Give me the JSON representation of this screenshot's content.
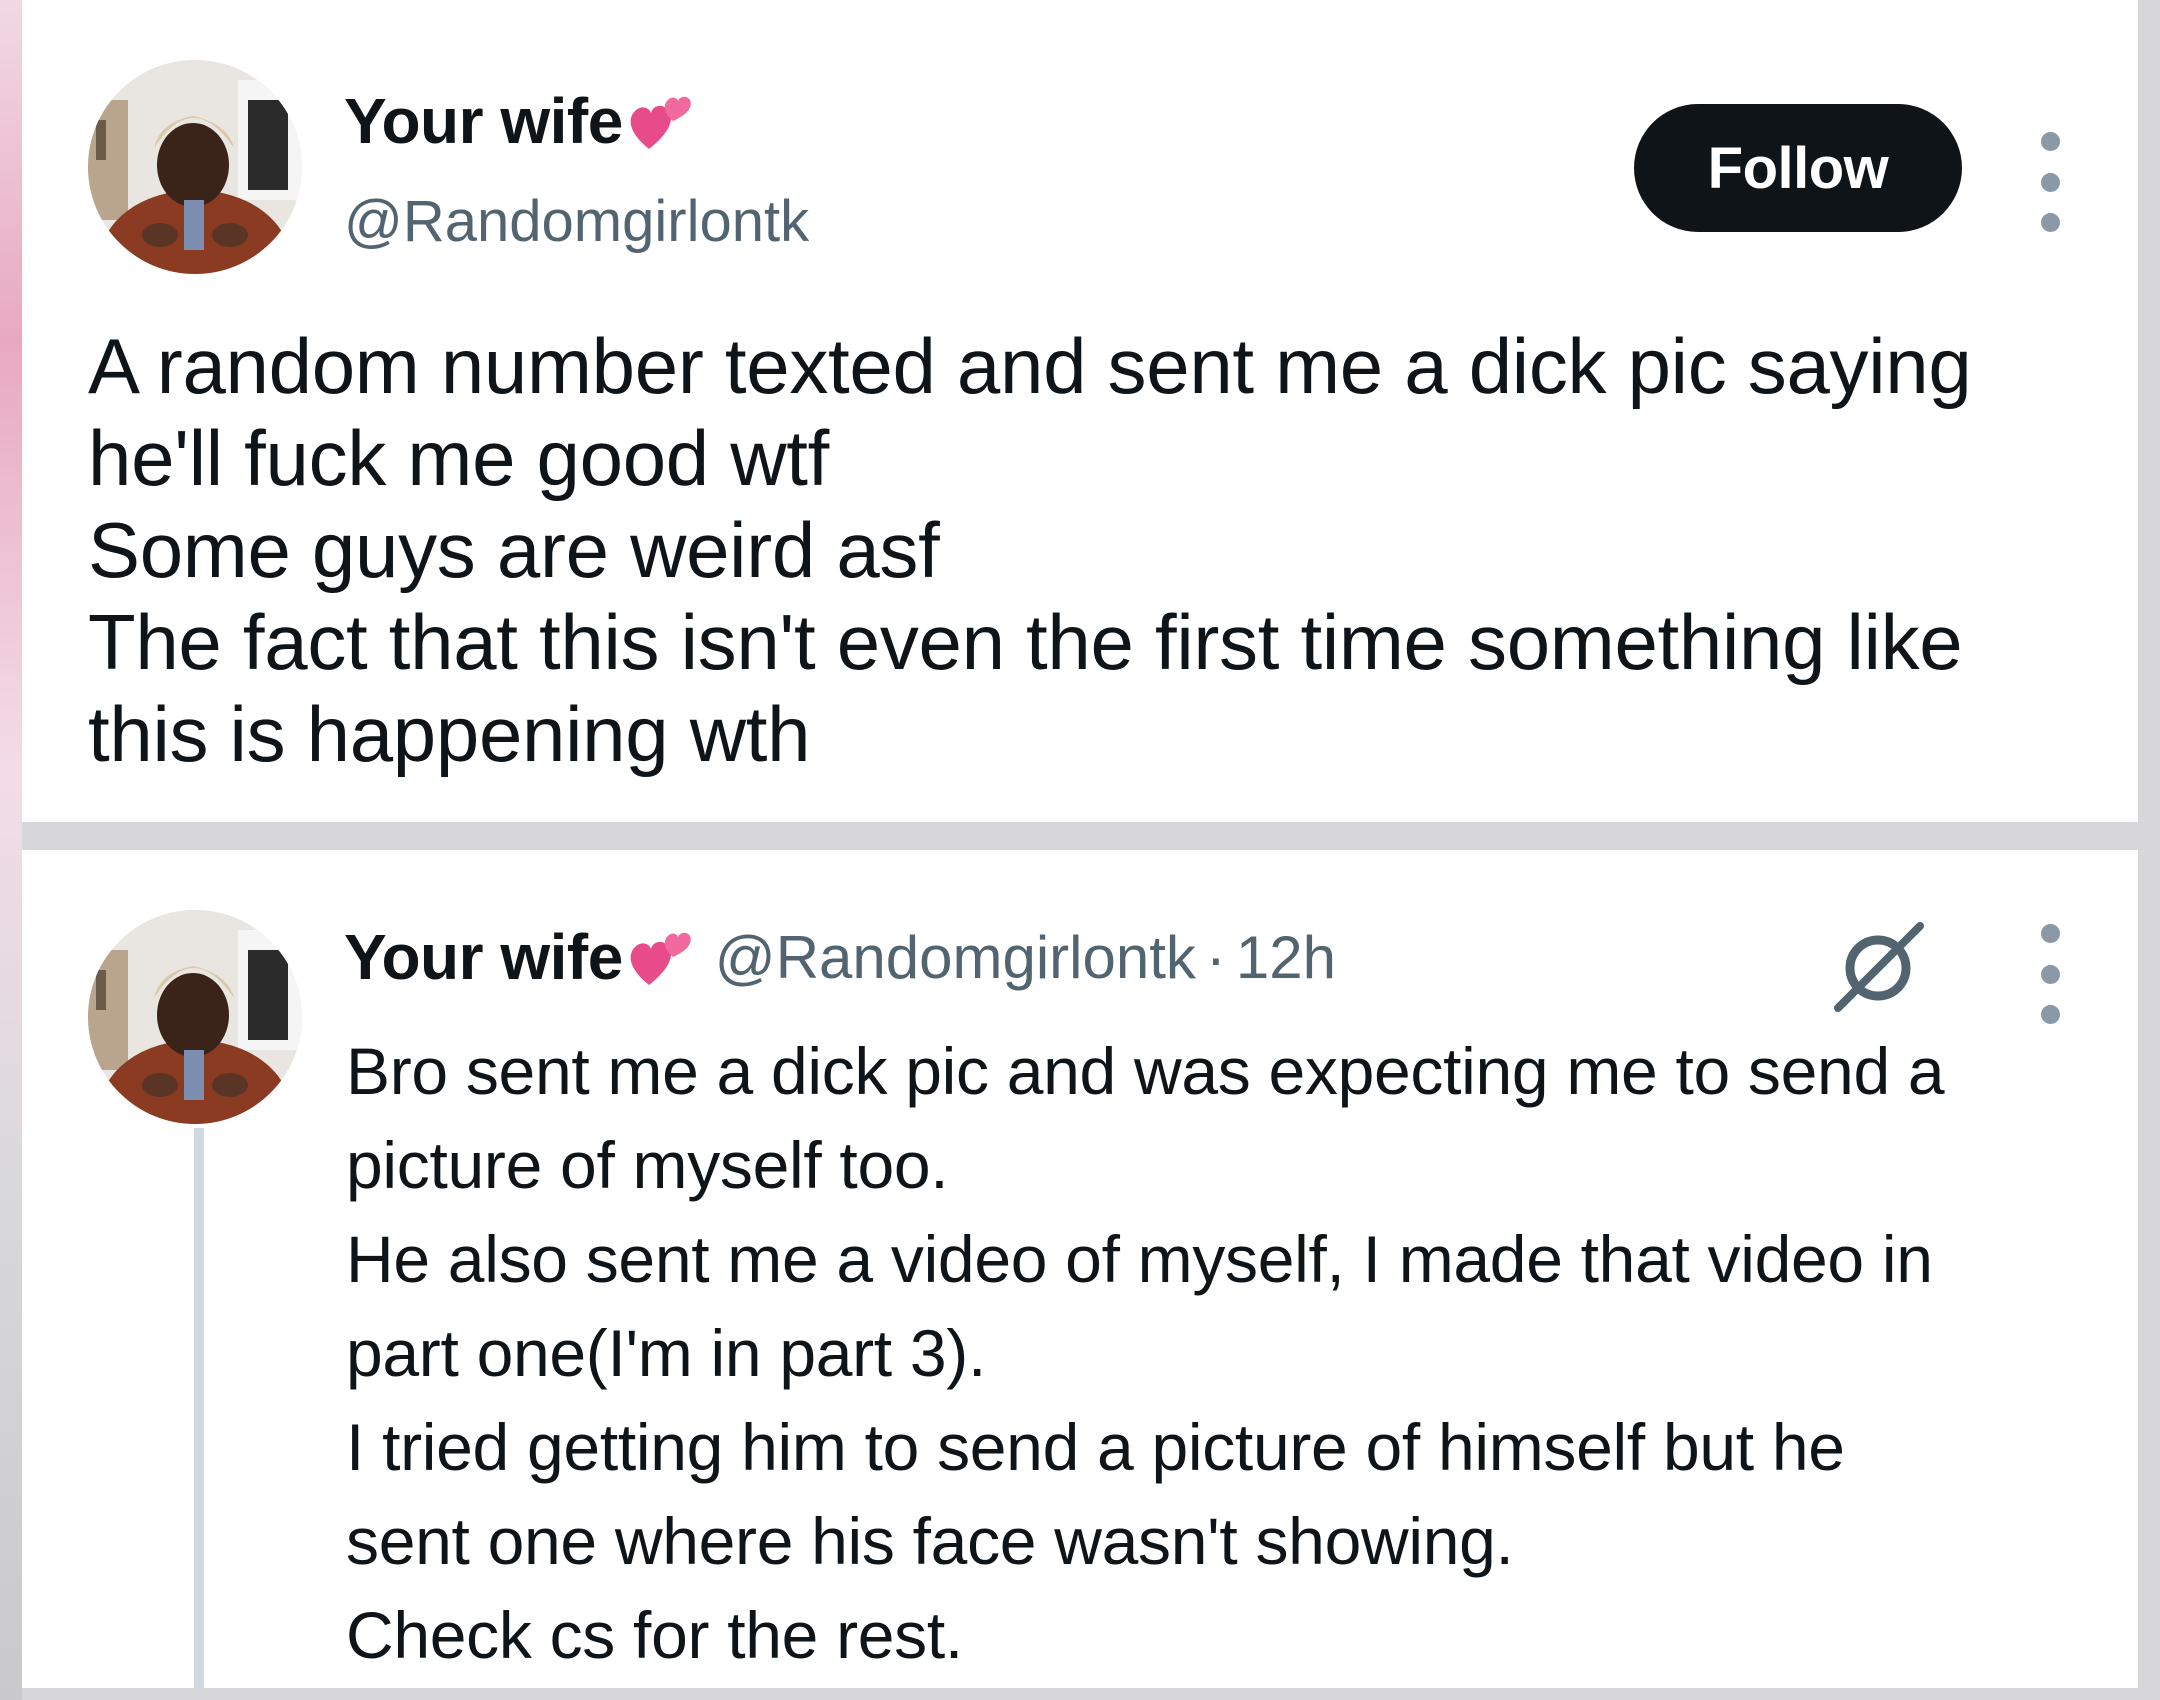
{
  "top_post": {
    "display_name": "Your wife",
    "handle": "@Randomgirlontk",
    "follow_label": "Follow",
    "text_lines": [
      "A random number texted and sent me a dick pic saying",
      "he'll fuck me good wtf",
      "Some guys are weird asf",
      "The fact that this isn't even the first time something like",
      "this is happening wth"
    ],
    "icons": [
      "avatar-photo",
      "two-hearts-emoji",
      "more-options-icon"
    ]
  },
  "reply_post": {
    "display_name": "Your wife",
    "handle": "@Randomgirlontk",
    "separator": "·",
    "timestamp": "12h",
    "text_lines": [
      "Bro sent me a dick pic and was expecting me to send a",
      "picture of myself too.",
      "He also sent me a video of myself, I made that video in",
      "part one(I'm in part 3).",
      "I tried getting him to send a picture of himself but he",
      "sent one where his face wasn't showing.",
      "Check cs for the rest."
    ],
    "icons": [
      "avatar-photo",
      "two-hearts-emoji",
      "grok-icon",
      "more-options-icon"
    ]
  },
  "colors": {
    "text_primary": "#0f1419",
    "text_secondary": "#536471",
    "follow_bg": "#0f1419",
    "heart_pink": "#e84b8a",
    "thread_line": "#cfd9de"
  }
}
